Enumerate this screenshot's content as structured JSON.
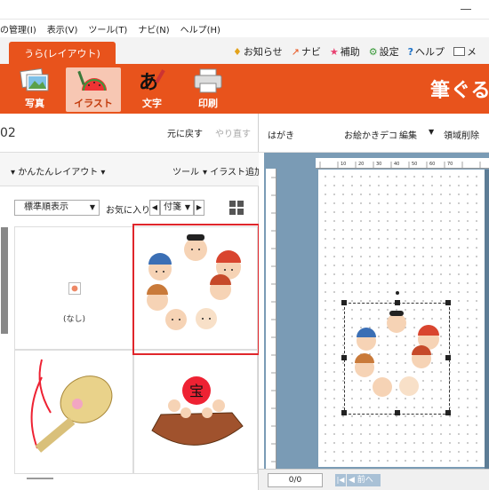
{
  "menubar": {
    "items": [
      "の管理(I)",
      "表示(V)",
      "ツール(T)",
      "ナビ(N)",
      "ヘルプ(H)"
    ]
  },
  "tabbar": {
    "active_tab": "うら(レイアウト)",
    "links": [
      {
        "icon": "bell-icon",
        "label": "お知らせ"
      },
      {
        "icon": "navi-arrow-icon",
        "label": "ナビ"
      },
      {
        "icon": "star-icon",
        "label": "補助"
      },
      {
        "icon": "gear-icon",
        "label": "設定"
      },
      {
        "icon": "help-icon",
        "label": "ヘルプ"
      },
      {
        "icon": "mail-icon",
        "label": "メ"
      }
    ]
  },
  "toolbar": {
    "buttons": [
      {
        "label": "写真",
        "icon": "photo-icon",
        "active": false
      },
      {
        "label": "イラスト",
        "icon": "illust-icon",
        "active": true
      },
      {
        "label": "文字",
        "icon": "brush-text-icon",
        "active": false
      },
      {
        "label": "印刷",
        "icon": "printer-icon",
        "active": false
      }
    ],
    "brand": "筆ぐる"
  },
  "left_panel": {
    "number": "02",
    "undo": "元に戻す",
    "redo": "やり直す",
    "easy_layout": "かんたんレイアウト",
    "tool": "ツール",
    "add_illust": "イラスト追加",
    "sort": "標準順表示",
    "favorites_label": "お気に入り",
    "favorites_value": "付箋",
    "none_label": "(なし)"
  },
  "right_panel": {
    "paper_type": "はがき",
    "deco": "お絵かきデコ",
    "edit": "編集",
    "delete_area": "領域削除",
    "ruler_labels": [
      "10",
      "20",
      "30",
      "40",
      "50",
      "60",
      "70"
    ],
    "page_value": "0/0",
    "nav_prev": "前へ"
  },
  "colors": {
    "brand_orange": "#e8531c",
    "selection_red": "#e0262b",
    "canvas_bg": "#7a9bb5"
  }
}
